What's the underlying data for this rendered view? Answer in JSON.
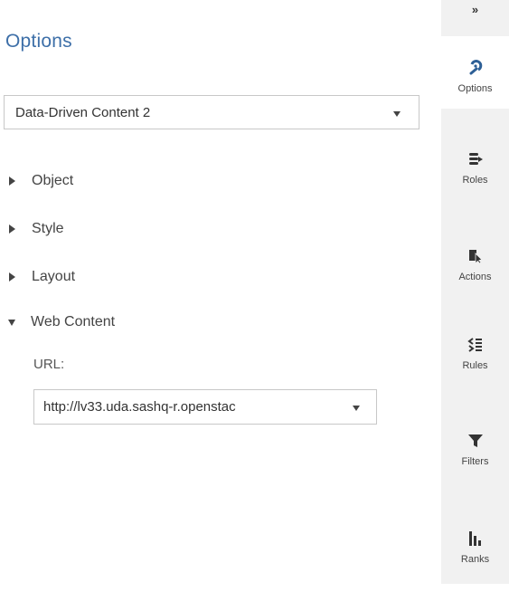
{
  "panel": {
    "title": "Options",
    "object_select": {
      "value": "Data-Driven Content 2"
    },
    "sections": [
      {
        "label": "Object",
        "expanded": false
      },
      {
        "label": "Style",
        "expanded": false
      },
      {
        "label": "Layout",
        "expanded": false
      },
      {
        "label": "Web Content",
        "expanded": true
      }
    ],
    "web_content": {
      "url_label": "URL:",
      "url_value": "http://lv33.uda.sashq-r.openstac"
    }
  },
  "rail": {
    "collapse_glyph": "»",
    "items": [
      {
        "label": "Options",
        "icon": "options-icon",
        "active": true
      },
      {
        "label": "Roles",
        "icon": "roles-icon"
      },
      {
        "label": "Actions",
        "icon": "actions-icon"
      },
      {
        "label": "Rules",
        "icon": "rules-icon"
      },
      {
        "label": "Filters",
        "icon": "filter-icon"
      },
      {
        "label": "Ranks",
        "icon": "ranks-icon"
      }
    ]
  },
  "colors": {
    "title": "#3d6fa8",
    "accent": "#2d5f96",
    "rail_bg": "#f1f1f1"
  }
}
